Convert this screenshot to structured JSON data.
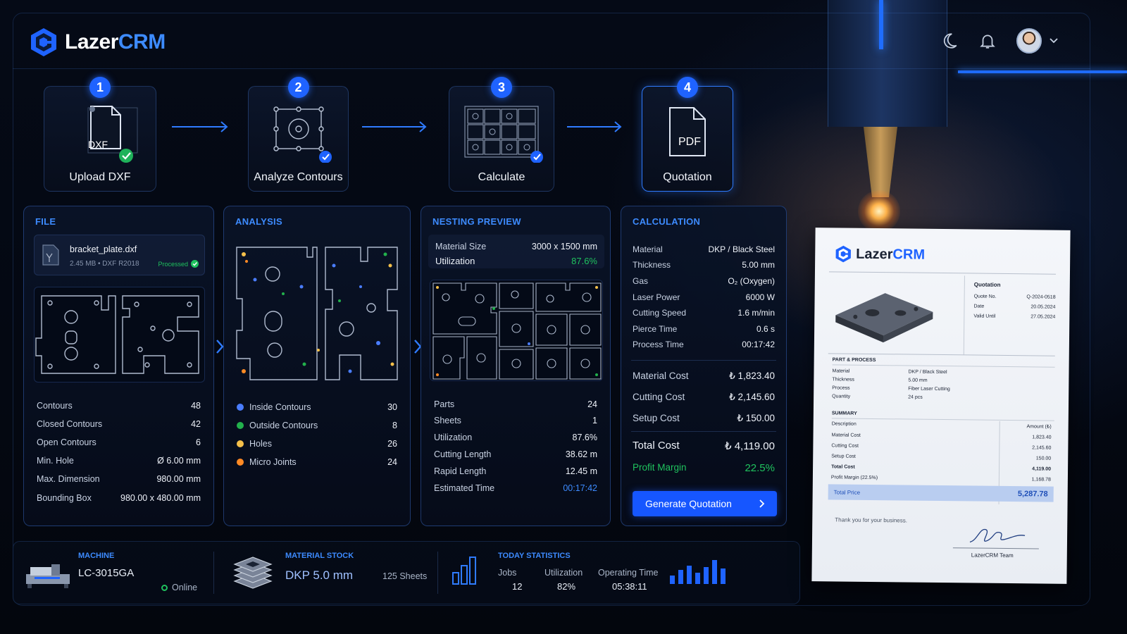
{
  "app": {
    "logo_part1": "Lazer",
    "logo_part2": "CRM"
  },
  "steps": [
    {
      "num": "1",
      "label": "Upload DXF",
      "icon_text": "DXF"
    },
    {
      "num": "2",
      "label": "Analyze Contours"
    },
    {
      "num": "3",
      "label": "Calculate"
    },
    {
      "num": "4",
      "label": "Quotation",
      "icon_text": "PDF"
    }
  ],
  "file": {
    "title": "FILE",
    "name": "bracket_plate.dxf",
    "meta": "2.45 MB  •  DXF R2018",
    "status": "Processed",
    "stats": [
      {
        "label": "Contours",
        "value": "48"
      },
      {
        "label": "Closed Contours",
        "value": "42"
      },
      {
        "label": "Open Contours",
        "value": "6"
      },
      {
        "label": "Min. Hole",
        "value": "Ø 6.00 mm"
      },
      {
        "label": "Max. Dimension",
        "value": "980.00 mm"
      },
      {
        "label": "Bounding Box",
        "value": "980.00 x 480.00 mm"
      }
    ]
  },
  "analysis": {
    "title": "ANALYSIS",
    "legend": [
      {
        "label": "Inside Contours",
        "value": "30",
        "color": "#4a7dff"
      },
      {
        "label": "Outside Contours",
        "value": "8",
        "color": "#22b14c"
      },
      {
        "label": "Holes",
        "value": "26",
        "color": "#f5c04a"
      },
      {
        "label": "Micro Joints",
        "value": "24",
        "color": "#ff8a24"
      }
    ]
  },
  "nesting": {
    "title": "NESTING PREVIEW",
    "material_size_label": "Material Size",
    "material_size": "3000 x 1500 mm",
    "utilization_label": "Utilization",
    "utilization": "87.6%",
    "stats": [
      {
        "label": "Parts",
        "value": "24"
      },
      {
        "label": "Sheets",
        "value": "1"
      },
      {
        "label": "Utilization",
        "value": "87.6%"
      },
      {
        "label": "Cutting Length",
        "value": "38.62 m"
      },
      {
        "label": "Rapid Length",
        "value": "12.45 m"
      },
      {
        "label": "Estimated Time",
        "value": "00:17:42"
      }
    ]
  },
  "calculation": {
    "title": "CALCULATION",
    "params": [
      {
        "label": "Material",
        "value": "DKP / Black Steel"
      },
      {
        "label": "Thickness",
        "value": "5.00 mm"
      },
      {
        "label": "Gas",
        "value": "O₂ (Oxygen)"
      },
      {
        "label": "Laser Power",
        "value": "6000 W"
      },
      {
        "label": "Cutting Speed",
        "value": "1.6 m/min"
      },
      {
        "label": "Pierce Time",
        "value": "0.6 s"
      },
      {
        "label": "Process Time",
        "value": "00:17:42"
      }
    ],
    "costs": [
      {
        "label": "Material Cost",
        "value": "₺ 1,823.40"
      },
      {
        "label": "Cutting Cost",
        "value": "₺ 2,145.60"
      },
      {
        "label": "Setup Cost",
        "value": "₺ 150.00"
      }
    ],
    "total_label": "Total Cost",
    "total_value": "₺ 4,119.00",
    "margin_label": "Profit Margin",
    "margin_value": "22.5%",
    "button_label": "Generate Quotation"
  },
  "bottom": {
    "machine_title": "MACHINE",
    "machine_name": "LC-3015GA",
    "machine_status": "Online",
    "stock_title": "MATERIAL STOCK",
    "stock_material": "DKP 5.0 mm",
    "stock_count": "125 Sheets",
    "stats_title": "TODAY STATISTICS",
    "jobs_label": "Jobs",
    "jobs_value": "12",
    "util_label": "Utilization",
    "util_value": "82%",
    "optime_label": "Operating Time",
    "optime_value": "05:38:11"
  },
  "doc": {
    "logo_part1": "Lazer",
    "logo_part2": "CRM",
    "quotation_title": "Quotation",
    "meta": [
      {
        "label": "Quote No.",
        "value": "Q-2024-0518"
      },
      {
        "label": "Date",
        "value": "20.05.2024"
      },
      {
        "label": "Valid Until",
        "value": "27.05.2024"
      }
    ],
    "part_title": "PART & PROCESS",
    "part_rows": [
      {
        "label": "Material",
        "value": "DKP / Black Steel"
      },
      {
        "label": "Thickness",
        "value": "5.00 mm"
      },
      {
        "label": "Process",
        "value": "Fiber Laser Cutting"
      },
      {
        "label": "Quantity",
        "value": "24 pcs"
      }
    ],
    "summary_title": "SUMMARY",
    "desc_header": "Description",
    "amount_header": "Amount (₺)",
    "summary_rows": [
      {
        "label": "Material Cost",
        "value": "1,823.40"
      },
      {
        "label": "Cutting Cost",
        "value": "2,145.60"
      },
      {
        "label": "Setup Cost",
        "value": "150.00"
      },
      {
        "label": "Total Cost",
        "value": "4,119.00"
      },
      {
        "label": "Profit Margin (22.5%)",
        "value": "1,168.78"
      }
    ],
    "total_label": "Total Price",
    "total_value": "5,287.78",
    "thanks": "Thank you for your business.",
    "team": "LazerCRM Team"
  }
}
